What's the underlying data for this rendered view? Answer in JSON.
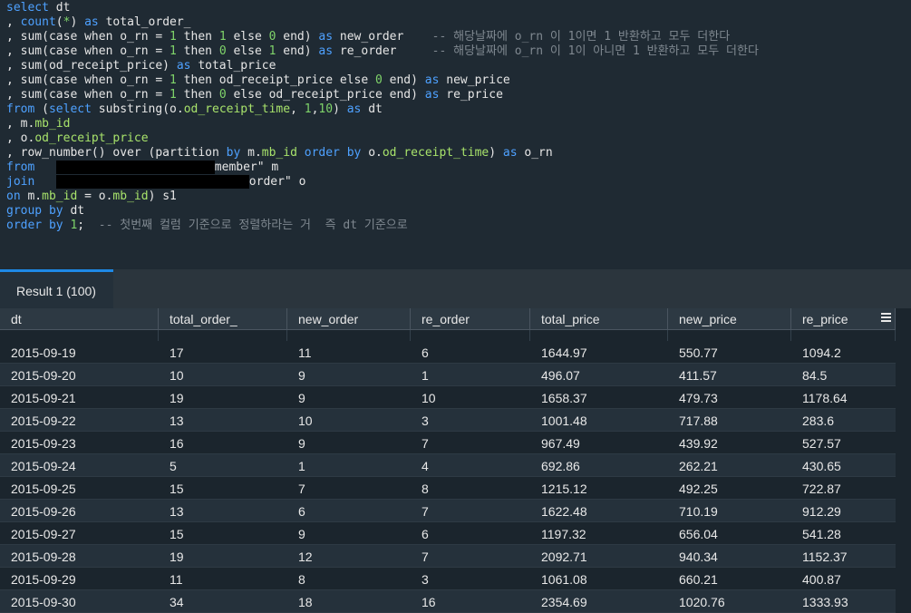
{
  "editor": {
    "lines": [
      "select dt",
      ", count(*) as total_order_",
      ", sum(case when o_rn = 1 then 1 else 0 end) as new_order",
      ", sum(case when o_rn = 1 then 0 else 1 end) as re_order",
      ", sum(od_receipt_price) as total_price",
      ", sum(case when o_rn = 1 then od_receipt_price else 0 end) as new_price",
      ", sum(case when o_rn = 1 then 0 else od_receipt_price end) as re_price",
      "from (select substring(o.od_receipt_time, 1,10) as dt",
      ", m.mb_id",
      ", o.od_receipt_price",
      ", row_number() over (partition by m.mb_id order by o.od_receipt_time) as o_rn",
      "from",
      "join",
      "on m.mb_id = o.mb_id) s1",
      "group by dt",
      "order by 1;"
    ],
    "comment_new": "-- 해당날짜에 o_rn 이 1이면 1 반환하고 모두 더한다",
    "comment_re": "-- 해당날짜에 o_rn 이 1이 아니면 1 반환하고 모두 더한다",
    "comment_order": "-- 첫번째 컬럼 기준으로 정렬하라는 거  즉 dt 기준으로",
    "from_tail": "member\" m",
    "join_tail": "order\" o"
  },
  "result_tab": {
    "label": "Result 1 (100)"
  },
  "table": {
    "columns": [
      "dt",
      "total_order_",
      "new_order",
      "re_order",
      "total_price",
      "new_price",
      "re_price"
    ],
    "rows": [
      [
        "2015-09-19",
        "17",
        "11",
        "6",
        "1644.97",
        "550.77",
        "1094.2"
      ],
      [
        "2015-09-20",
        "10",
        "9",
        "1",
        "496.07",
        "411.57",
        "84.5"
      ],
      [
        "2015-09-21",
        "19",
        "9",
        "10",
        "1658.37",
        "479.73",
        "1178.64"
      ],
      [
        "2015-09-22",
        "13",
        "10",
        "3",
        "1001.48",
        "717.88",
        "283.6"
      ],
      [
        "2015-09-23",
        "16",
        "9",
        "7",
        "967.49",
        "439.92",
        "527.57"
      ],
      [
        "2015-09-24",
        "5",
        "1",
        "4",
        "692.86",
        "262.21",
        "430.65"
      ],
      [
        "2015-09-25",
        "15",
        "7",
        "8",
        "1215.12",
        "492.25",
        "722.87"
      ],
      [
        "2015-09-26",
        "13",
        "6",
        "7",
        "1622.48",
        "710.19",
        "912.29"
      ],
      [
        "2015-09-27",
        "15",
        "9",
        "6",
        "1197.32",
        "656.04",
        "541.28"
      ],
      [
        "2015-09-28",
        "19",
        "12",
        "7",
        "2092.71",
        "940.34",
        "1152.37"
      ],
      [
        "2015-09-29",
        "11",
        "8",
        "3",
        "1061.08",
        "660.21",
        "400.87"
      ],
      [
        "2015-09-30",
        "34",
        "18",
        "16",
        "2354.69",
        "1020.76",
        "1333.93"
      ]
    ]
  }
}
